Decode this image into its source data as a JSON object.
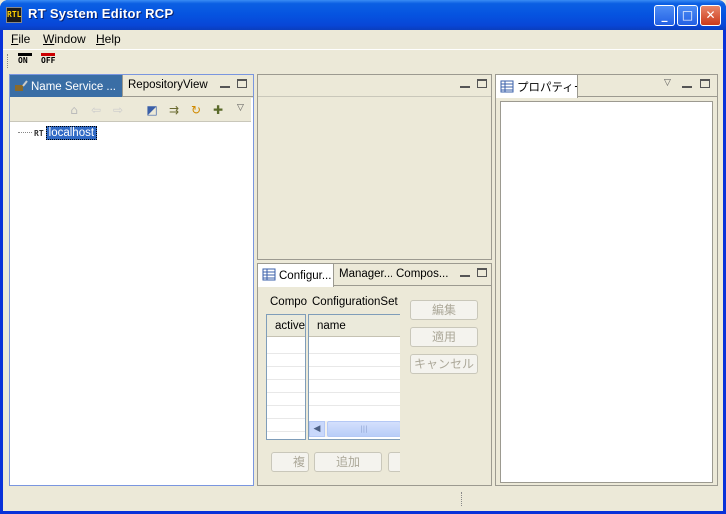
{
  "window": {
    "title": "RT System Editor RCP",
    "icon_text": "RTL",
    "controls": {
      "minimize": "_",
      "maximize": "□",
      "close": "✕"
    }
  },
  "menu": {
    "items": [
      {
        "key": "F",
        "rest": "ile"
      },
      {
        "key": "W",
        "rest": "indow"
      },
      {
        "key": "H",
        "rest": "elp"
      }
    ]
  },
  "toolbar": {
    "on_label": "ON",
    "off_label": "OFF"
  },
  "name_service_panel": {
    "tabs": [
      {
        "label": "Name Service ..."
      },
      {
        "label": "RepositoryView"
      }
    ],
    "tree": {
      "node_icon": "RT",
      "node_label": "localhost"
    }
  },
  "properties_panel": {
    "tab_label": "プロパティー"
  },
  "config_panel": {
    "tabs": [
      {
        "label": "Configur..."
      },
      {
        "label": "Manager..."
      },
      {
        "label": "Compos..."
      }
    ],
    "left_label": "Compo",
    "right_label": "ConfigurationSet",
    "left_column": "active",
    "right_column": "name",
    "buttons": {
      "edit": "編集",
      "apply": "適用",
      "cancel": "キャンセル",
      "copy": "複",
      "add": "追加"
    }
  },
  "colors": {
    "title_bar": "#0553e0",
    "selection": "#316ac5",
    "active_tab": "#3a6ea5",
    "face": "#ece9d8"
  }
}
